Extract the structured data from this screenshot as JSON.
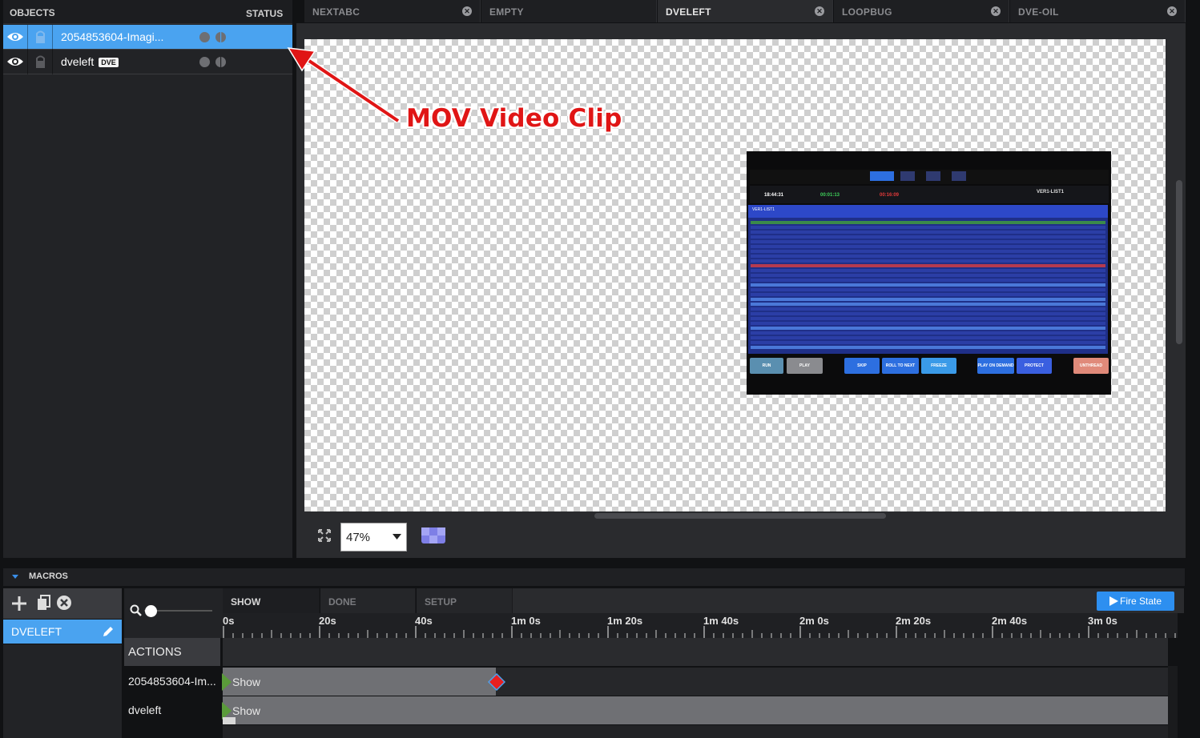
{
  "objects_panel": {
    "header_left": "OBJECTS",
    "header_right": "STATUS",
    "items": [
      {
        "name": "2054853604-Imagi...",
        "badge": ""
      },
      {
        "name": "dveleft",
        "badge": "DVE"
      }
    ]
  },
  "tabs": [
    {
      "label": "NEXTABC",
      "closable": true
    },
    {
      "label": "EMPTY",
      "closable": false
    },
    {
      "label": "DVELEFT",
      "closable": true,
      "active": true
    },
    {
      "label": "LOOPBUG",
      "closable": true
    },
    {
      "label": "DVE-OIL",
      "closable": true
    }
  ],
  "annotation": {
    "text": "MOV Video Clip",
    "color": "#e01515"
  },
  "clip_preview": {
    "time1": "18:44:31",
    "time2": "00:01:13",
    "time3": "00:16:09",
    "list_title": "VER1-LIST1",
    "buttons": [
      "RUN",
      "PLAY",
      "SKIP",
      "ROLL TO NEXT",
      "FREEZE",
      "PLAY ON DEMAND",
      "PROTECT",
      "UNTHREAD"
    ]
  },
  "canvas_toolbar": {
    "zoom": "47%"
  },
  "macros": {
    "label": "MACROS",
    "selected_macro": "DVELEFT",
    "state_tabs": [
      "SHOW",
      "DONE",
      "SETUP"
    ],
    "fire_button": "Fire State",
    "ruler_ticks": [
      "0s",
      "20s",
      "40s",
      "1m 0s",
      "1m 20s",
      "1m 40s",
      "2m 0s",
      "2m 20s",
      "2m 40s",
      "3m 0s"
    ],
    "actions_label": "ACTIONS",
    "rows": [
      {
        "label": "2054853604-Im...",
        "action": "Show"
      },
      {
        "label": "dveleft",
        "action": "Show"
      }
    ]
  },
  "colors": {
    "accent": "#4aa3f0",
    "fire": "#2d8ff0",
    "keyframe_start": "#5a9b3a",
    "keyframe_end": "#e82020"
  }
}
